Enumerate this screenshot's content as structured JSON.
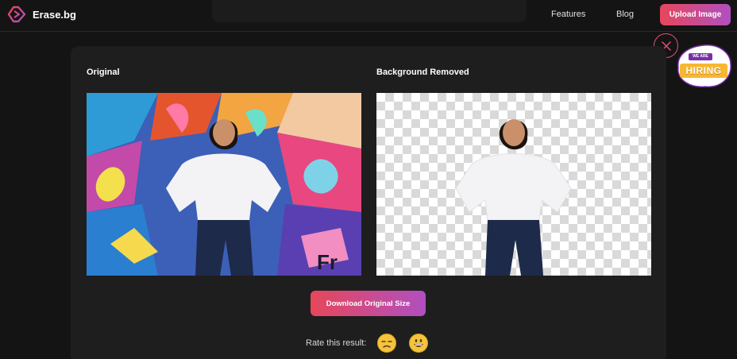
{
  "header": {
    "logo_text": "Erase.bg",
    "nav": {
      "features": "Features",
      "blog": "Blog"
    },
    "upload_label": "Upload Image"
  },
  "hiring_badge": {
    "top": "WE ARE",
    "main": "HIRING"
  },
  "main": {
    "original_title": "Original",
    "removed_title": "Background Removed",
    "download_label": "Download Original Size",
    "rate_label": "Rate this result:"
  },
  "colors": {
    "accent_start": "#e6475a",
    "accent_end": "#b04fc0",
    "bg": "#141414",
    "card": "#1e1e1e"
  },
  "icons": [
    "erase-bg-logo-icon",
    "close-icon",
    "unamused-face-icon",
    "grinning-face-icon"
  ]
}
